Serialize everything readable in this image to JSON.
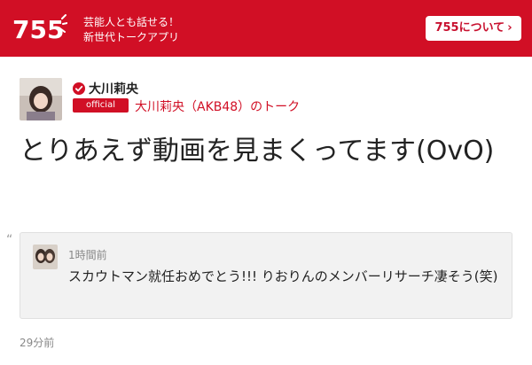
{
  "header": {
    "logo_text": "755",
    "tagline_line1": "芸能人とも話せる！",
    "tagline_line2": "新世代トークアプリ",
    "about_button": "755について",
    "about_chevron": "›"
  },
  "profile": {
    "name": "大川莉央",
    "badge": "official",
    "talk_link": "大川莉央（AKB48）のトーク"
  },
  "post": {
    "text": "とりあえず動画を見まくってます(OvO)",
    "time": "29分前"
  },
  "reply": {
    "quote_mark": "“",
    "time": "1時間前",
    "text": "スカウトマン就任おめでとう!!! りおりんのメンバーリサーチ凄そう(笑)"
  },
  "colors": {
    "brand_red": "#d10f25"
  },
  "icons": {
    "verified": "verified-check-icon",
    "chevron": "chevron-right-icon"
  }
}
